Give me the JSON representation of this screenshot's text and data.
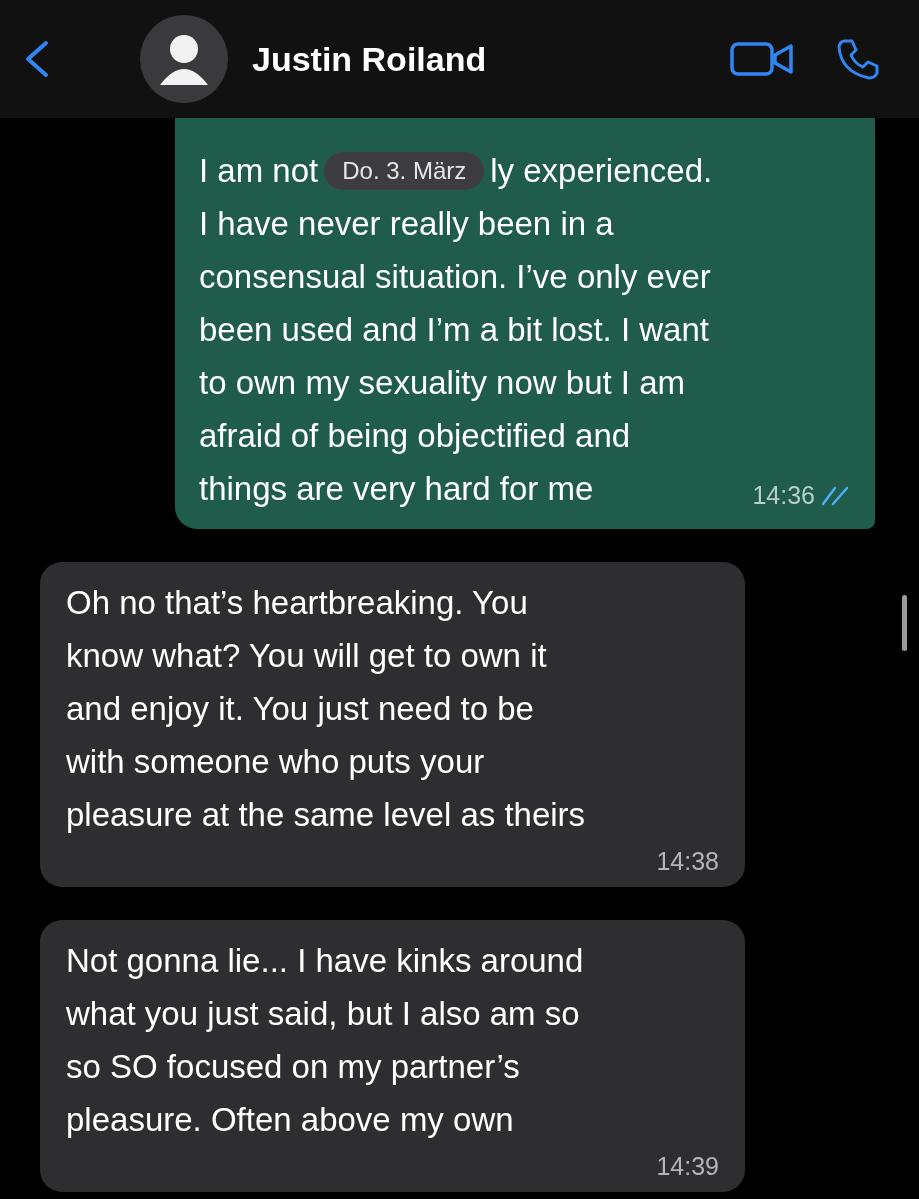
{
  "header": {
    "contact_name": "Justin Roiland"
  },
  "messages": [
    {
      "kind": "outgoing",
      "lead": "I am not",
      "date_badge": "Do. 3. März",
      "lead_rest": "ly experienced.",
      "text": "I have never really been in a\nconsensual situation. I’ve only ever\nbeen used and I’m a bit lost. I want\nto own my sexuality now but I am\nafraid of being objectified and\nthings are very hard for me",
      "time": "14:36",
      "read": true
    },
    {
      "kind": "incoming",
      "text": "Oh no that’s heartbreaking. You\nknow what? You will get to own it\nand enjoy it. You just need to be\nwith someone who puts your\npleasure at the same level as theirs",
      "time": "14:38"
    },
    {
      "kind": "incoming",
      "text": "Not gonna lie... I have kinks around\nwhat you just said, but I also am so\nso SO focused on my partner’s\npleasure. Often above my own",
      "time": "14:39"
    }
  ]
}
